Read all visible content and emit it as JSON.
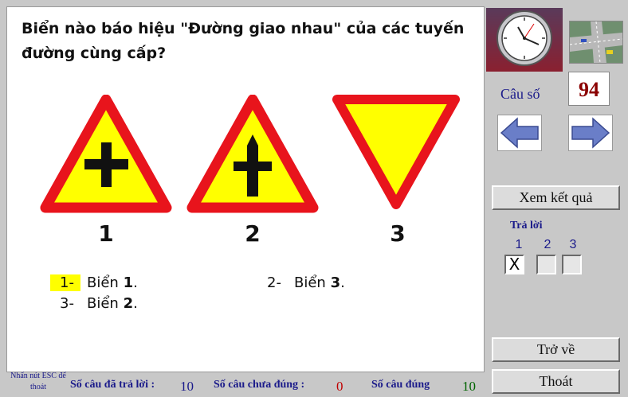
{
  "question": {
    "text": "Biển nào báo hiệu \"Đường giao nhau\" của các tuyến đường cùng cấp?",
    "sign_numbers": [
      "1",
      "2",
      "3"
    ],
    "answers": [
      {
        "label": "1-",
        "prefix": "Biển ",
        "bold": "1",
        "suffix": ".",
        "selected": true
      },
      {
        "label": "2-",
        "prefix": "Biển ",
        "bold": "3",
        "suffix": ".",
        "selected": false
      },
      {
        "label": "3-",
        "prefix": "Biển ",
        "bold": "2",
        "suffix": ".",
        "selected": false
      }
    ]
  },
  "side": {
    "cau_so_label": "Câu số",
    "cau_so_value": "94",
    "xem_ket_qua": "Xem kết quả",
    "tra_loi_label": "Trả lời",
    "options": [
      "1",
      "2",
      "3"
    ],
    "checked": [
      "X",
      "",
      ""
    ],
    "tro_ve": "Trở về",
    "thoat": "Thoát"
  },
  "footer": {
    "esc_note": "Nhấn nút ESC để thoát",
    "answered_label": "Số câu đã trả lời :",
    "answered_value": "10",
    "wrong_label": "Số câu chưa  đúng :",
    "wrong_value": "0",
    "correct_label": "Số câu đúng",
    "correct_value": "10"
  },
  "colors": {
    "sign_red": "#e8141c",
    "sign_yellow": "#ffff00",
    "label_blue": "#1a1a8a",
    "number_red": "#8b0000",
    "correct_green": "#006400"
  },
  "icons": [
    "clock-icon",
    "intersection-map-icon",
    "arrow-left-icon",
    "arrow-right-icon"
  ]
}
